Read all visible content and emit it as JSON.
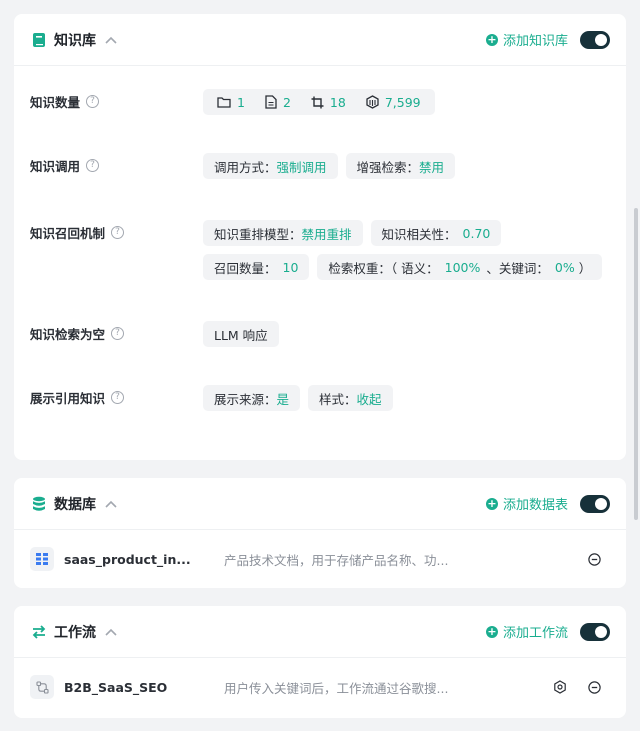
{
  "knowledge": {
    "title": "知识库",
    "add_label": "添加知识库",
    "enabled": true,
    "rows": {
      "count": {
        "label": "知识数量",
        "folders": "1",
        "docs": "2",
        "slices": "18",
        "tokens": "7,599"
      },
      "call": {
        "label": "知识调用",
        "mode_key": "调用方式：",
        "mode_val": "强制调用",
        "enhance_key": "增强检索：",
        "enhance_val": "禁用"
      },
      "recall": {
        "label": "知识召回机制",
        "rerank_key": "知识重排模型：",
        "rerank_val": "禁用重排",
        "relevance_key": "知识相关性：",
        "relevance_val": "0.70",
        "count_key": "召回数量：",
        "count_val": "10",
        "weight_prefix": "检索权重：（ 语义：",
        "semantic_val": "100%",
        "weight_mid": "、关键词：",
        "keyword_val": "0%",
        "weight_suffix": "）"
      },
      "empty": {
        "label": "知识检索为空",
        "value": "LLM 响应"
      },
      "cite": {
        "label": "展示引用知识",
        "source_key": "展示来源：",
        "source_val": "是",
        "style_key": "样式：",
        "style_val": "收起"
      }
    }
  },
  "database": {
    "title": "数据库",
    "add_label": "添加数据表",
    "enabled": true,
    "items": [
      {
        "name": "saas_product_in...",
        "desc": "产品技术文档，用于存储产品名称、功...",
        "icon": "table-icon"
      }
    ]
  },
  "workflow": {
    "title": "工作流",
    "add_label": "添加工作流",
    "enabled": true,
    "items": [
      {
        "name": "B2B_SaaS_SEO",
        "desc": "用户传入关键词后，工作流通过谷歌搜...",
        "icon": "workflow-icon"
      }
    ]
  },
  "colors": {
    "accent": "#1aad8f",
    "toggle_on": "#17313a",
    "background": "#f2f3f5"
  }
}
